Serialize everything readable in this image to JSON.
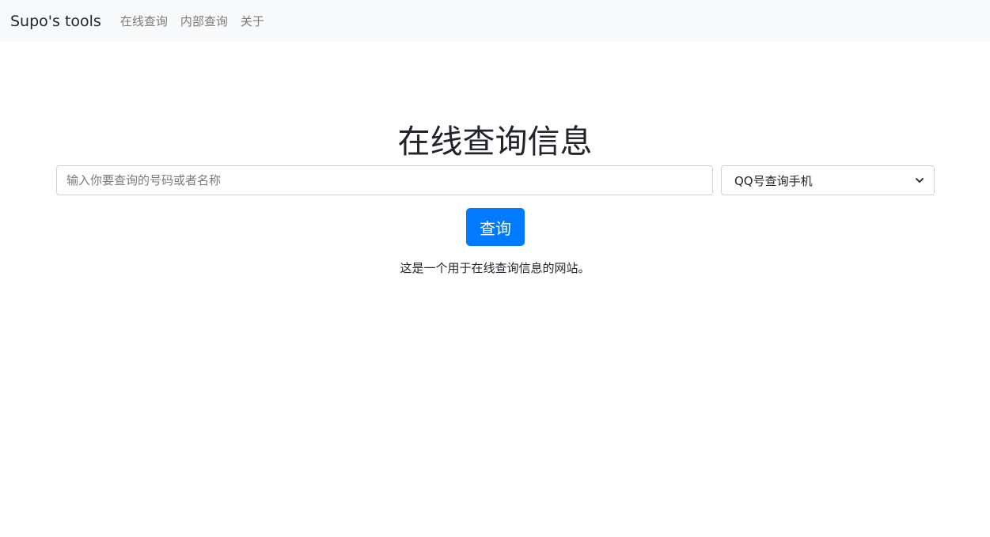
{
  "navbar": {
    "brand": "Supo's tools",
    "links": [
      {
        "label": "在线查询"
      },
      {
        "label": "内部查询"
      },
      {
        "label": "关于"
      }
    ],
    "background": "#f8f9fa"
  },
  "main": {
    "title": "在线查询信息",
    "search": {
      "placeholder": "输入你要查询的号码或者名称",
      "value": ""
    },
    "select": {
      "selected": "QQ号查询手机"
    },
    "submit_label": "查询",
    "description": "这是一个用于在线查询信息的网站。"
  },
  "colors": {
    "accent": "#007bff",
    "nav_link": "#7a7a7a"
  }
}
